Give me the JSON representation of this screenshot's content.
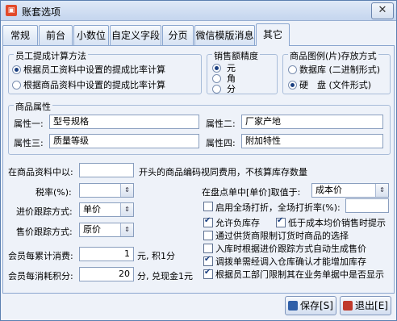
{
  "window": {
    "title": "账套选项",
    "close_glyph": "✕"
  },
  "tabs": [
    {
      "label": "常规"
    },
    {
      "label": "前台"
    },
    {
      "label": "小数位"
    },
    {
      "label": "自定义字段"
    },
    {
      "label": "分页"
    },
    {
      "label": "微信模版消息"
    },
    {
      "label": "其它",
      "active": true
    }
  ],
  "commission": {
    "title": "员工提成计算方法",
    "options": [
      "根据员工资料中设置的提成比率计算",
      "根据商品资料中设置的提成比率计算"
    ],
    "selected": 0
  },
  "precision": {
    "title": "销售额精度",
    "options": [
      "元",
      "角",
      "分"
    ],
    "selected": 0
  },
  "image_storage": {
    "title": "商品图例(片)存放方式",
    "options": [
      "数据库 (二进制形式)",
      "硬　盘 (文件形式)"
    ],
    "selected": 1
  },
  "attributes": {
    "title": "商品属性",
    "items": [
      {
        "label": "属性一:",
        "value": "型号规格"
      },
      {
        "label": "属性二:",
        "value": "厂家产地"
      },
      {
        "label": "属性三:",
        "value": "质量等级"
      },
      {
        "label": "属性四:",
        "value": "附加特性"
      }
    ]
  },
  "prefix_row": {
    "label": "在商品资料中以:",
    "value": "",
    "suffix": "开头的商品编码视同费用，不核算库存数量"
  },
  "tax": {
    "label": "税率(%):",
    "value": ""
  },
  "purchase_track": {
    "label": "进价跟踪方式:",
    "value": "单价"
  },
  "sale_track": {
    "label": "售价跟踪方式:",
    "value": "原价"
  },
  "member_spend": {
    "label": "会员每累计消费:",
    "value": "1",
    "suffix": "元, 积1分"
  },
  "member_points": {
    "label": "会员每消耗积分:",
    "value": "20",
    "suffix": "分, 兑现金1元"
  },
  "inventory_price": {
    "label": "在盘点单中[单价]取值于:",
    "value": "成本价"
  },
  "discount": {
    "label": "启用全场打折，全场打折率(%):",
    "checked": false,
    "value": ""
  },
  "options": [
    {
      "label": "允许负库存",
      "checked": true
    },
    {
      "label": "低于成本均价销售时提示",
      "checked": true
    },
    {
      "label": "通过供货商限制订货时商品的选择",
      "checked": false
    },
    {
      "label": "入库时根据进价跟踪方式自动生成售价",
      "checked": false
    },
    {
      "label": "调拨单需经调入仓库确认才能增加库存",
      "checked": true
    },
    {
      "label": "根据员工部门限制其在业务单据中是否显示",
      "checked": true
    }
  ],
  "buttons": {
    "save": "保存[S]",
    "exit": "退出[E]"
  },
  "colors": {
    "accent": "#1a3f80",
    "border": "#8aa6cf",
    "panel_bg": "#eef2f9"
  }
}
